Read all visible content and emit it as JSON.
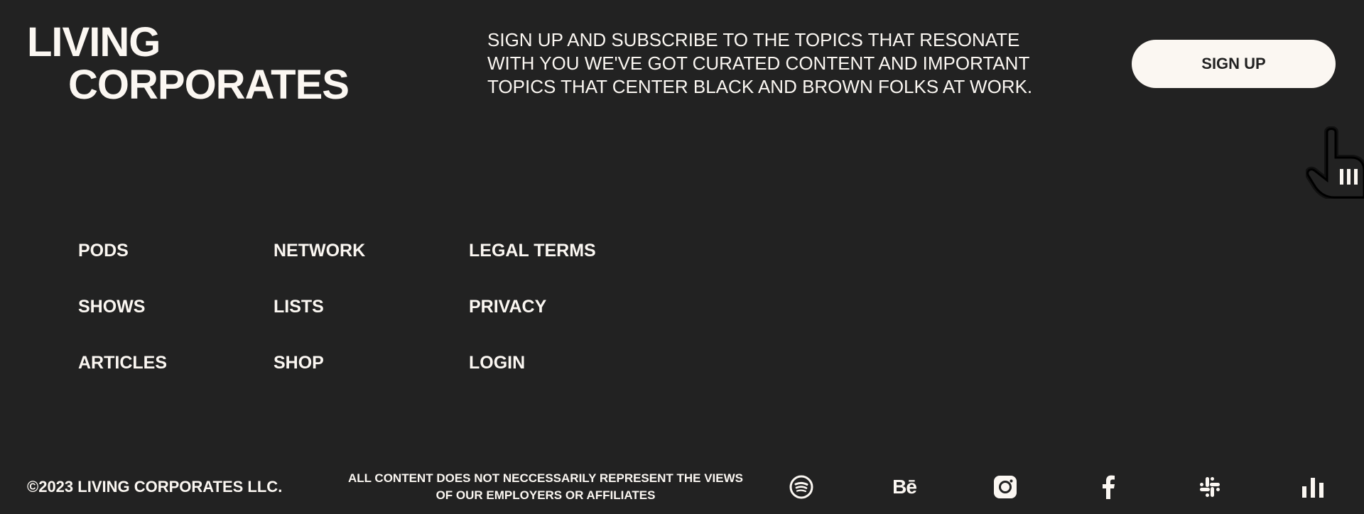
{
  "brand": {
    "logo_line1": "LIVING",
    "logo_line2": "CORPORATES"
  },
  "signup": {
    "text": "SIGN UP AND SUBSCRIBE TO THE TOPICS THAT RESONATE WITH YOU WE'VE GOT CURATED CONTENT AND IMPORTANT TOPICS THAT CENTER BLACK AND BROWN FOLKS AT WORK.",
    "button_label": "SIGN UP"
  },
  "nav": {
    "columns": [
      [
        "PODS",
        "SHOWS",
        "ARTICLES"
      ],
      [
        "NETWORK",
        "LISTS",
        "SHOP"
      ],
      [
        "LEGAL TERMS",
        "PRIVACY",
        "LOGIN"
      ]
    ]
  },
  "footer": {
    "copyright": "©2023 LIVING CORPORATES LLC.",
    "disclaimer_line1": "ALL CONTENT DOES NOT NECCESSARILY REPRESENT THE VIEWS",
    "disclaimer_line2": "OF OUR EMPLOYERS OR AFFILIATES",
    "behance_glyph": "Bē"
  },
  "social_icons": [
    "spotify-icon",
    "behance-icon",
    "instagram-icon",
    "facebook-icon",
    "slack-icon",
    "chart-icon"
  ],
  "colors": {
    "background": "#222222",
    "foreground": "#fbf7f2",
    "button_text": "#222222"
  }
}
